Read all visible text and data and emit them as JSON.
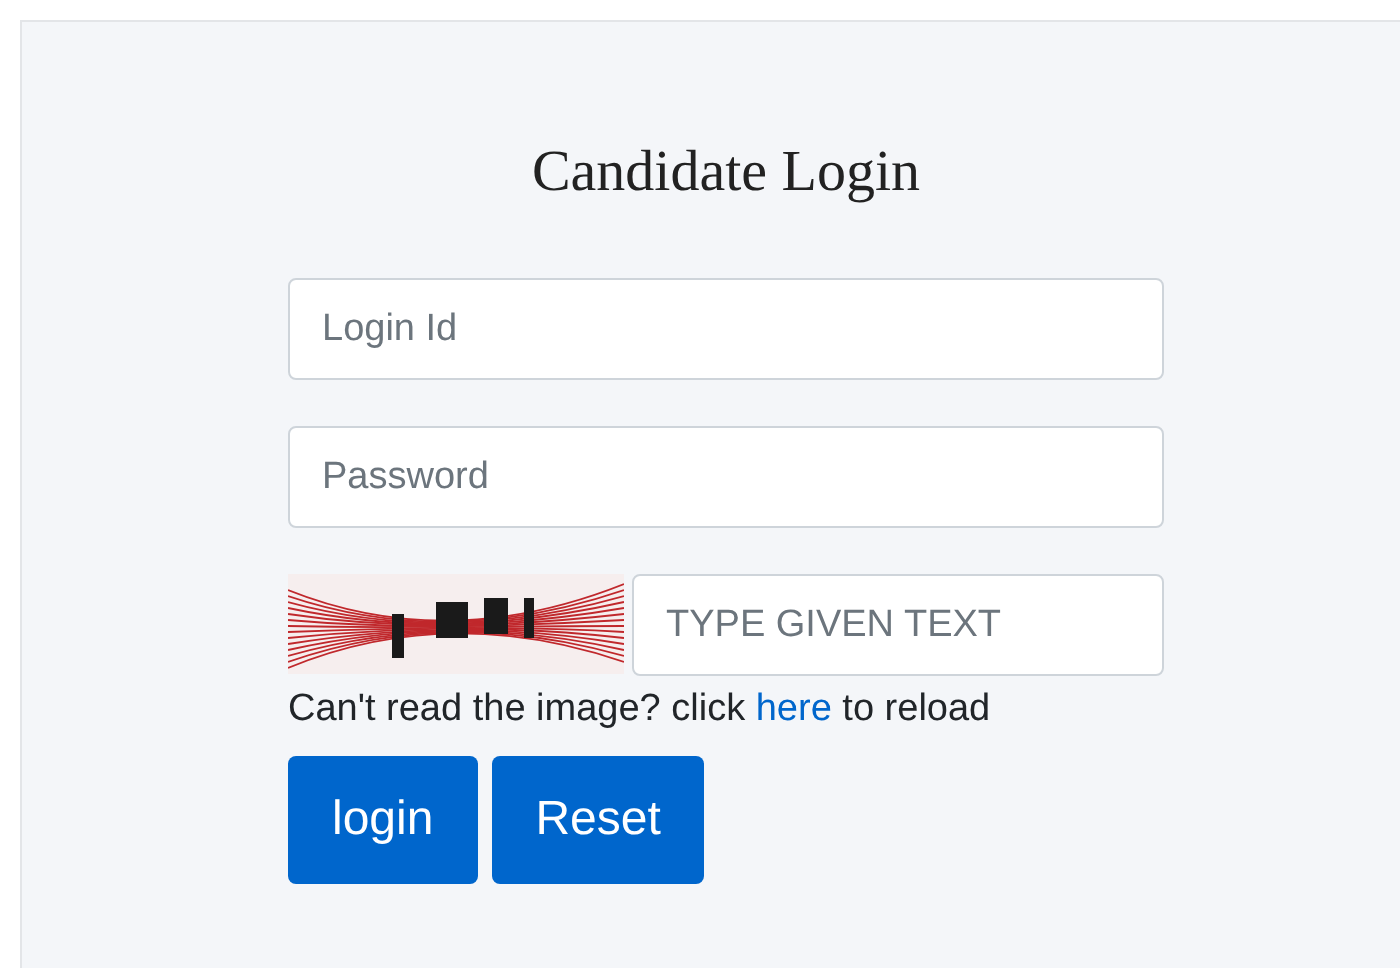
{
  "title": "Candidate Login",
  "fields": [
    {
      "placeholder": "Login Id"
    },
    {
      "placeholder": "Password"
    }
  ],
  "captcha": {
    "placeholder": "TYPE GIVEN TEXT"
  },
  "reload_note": {
    "before": "Can't read the image? click ",
    "link": "here",
    "after": " to reload"
  },
  "buttons": [
    "login",
    "Reset"
  ]
}
